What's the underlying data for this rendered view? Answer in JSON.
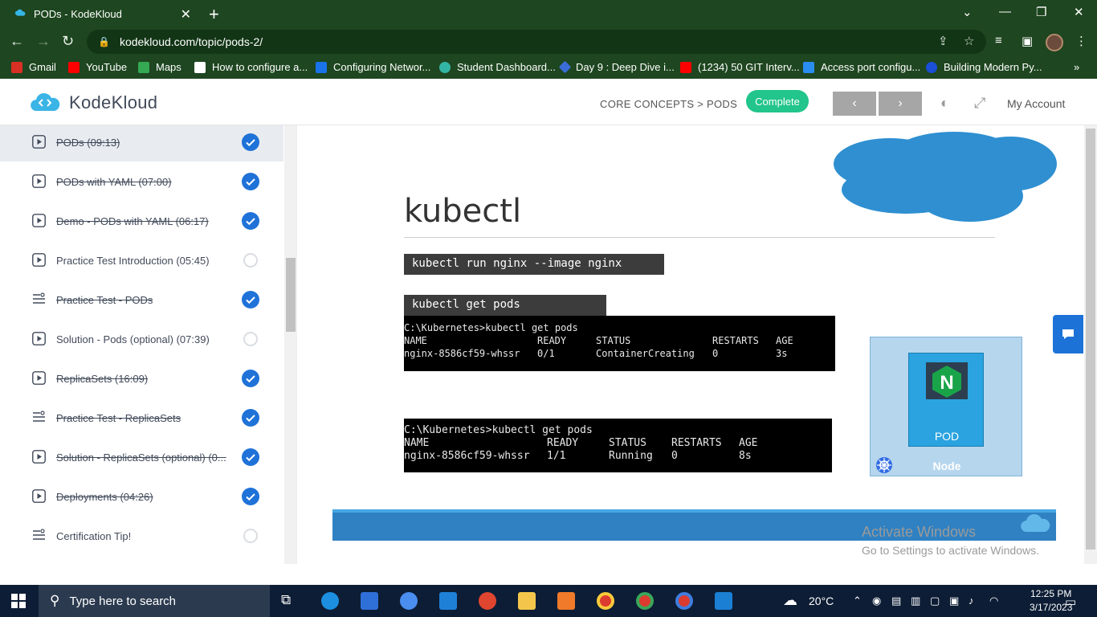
{
  "browser": {
    "tab_title": "PODs - KodeKloud",
    "url": "kodekloud.com/topic/pods-2/",
    "bookmarks": [
      {
        "label": "Gmail",
        "color": "#d93025"
      },
      {
        "label": "YouTube",
        "color": "#ff0000"
      },
      {
        "label": "Maps",
        "color": "#34a853"
      },
      {
        "label": "How to configure a...",
        "color": "#ffffff"
      },
      {
        "label": "Configuring Networ...",
        "color": "#1a73e8"
      },
      {
        "label": "Student Dashboard...",
        "color": "#33b5a5"
      },
      {
        "label": "Day 9 : Deep Dive i...",
        "color": "#3b6dd8"
      },
      {
        "label": "(1234) 50 GIT Interv...",
        "color": "#ff0000"
      },
      {
        "label": "Access port configu...",
        "color": "#2a8df0"
      },
      {
        "label": "Building Modern Py...",
        "color": "#1a4fd6"
      }
    ]
  },
  "header": {
    "logo": "KodeKloud",
    "breadcrumb": "CORE CONCEPTS > PODS",
    "complete_label": "Complete",
    "prev_label": "‹",
    "next_label": "›",
    "account_label": "My Account"
  },
  "sidebar": {
    "lessons": [
      {
        "title": "PODs (09:13)",
        "type": "video",
        "done": true,
        "active": true
      },
      {
        "title": "PODs with YAML (07:00)",
        "type": "video",
        "done": true,
        "active": false
      },
      {
        "title": "Demo - PODs with YAML (06:17)",
        "type": "video",
        "done": true,
        "active": false
      },
      {
        "title": "Practice Test Introduction (05:45)",
        "type": "video",
        "done": false,
        "active": false
      },
      {
        "title": "Practice Test - PODs",
        "type": "lab",
        "done": true,
        "active": false
      },
      {
        "title": "Solution - Pods (optional) (07:39)",
        "type": "video",
        "done": false,
        "active": false
      },
      {
        "title": "ReplicaSets (16:09)",
        "type": "video",
        "done": true,
        "active": false
      },
      {
        "title": "Practice Test - ReplicaSets",
        "type": "lab",
        "done": true,
        "active": false
      },
      {
        "title": "Solution - ReplicaSets (optional) (0...",
        "type": "video",
        "done": true,
        "active": false
      },
      {
        "title": "Deployments (04:26)",
        "type": "video",
        "done": true,
        "active": false
      },
      {
        "title": "Certification Tip!",
        "type": "lab",
        "done": false,
        "active": false
      }
    ]
  },
  "slide": {
    "title": "kubectl",
    "cmd1": "kubectl run nginx --image nginx",
    "cmd2": "kubectl get pods",
    "term1": {
      "prompt": "C:\\Kubernetes>kubectl get pods",
      "headers": [
        "NAME",
        "READY",
        "STATUS",
        "RESTARTS",
        "AGE"
      ],
      "row": [
        "nginx-8586cf59-whssr",
        "0/1",
        "ContainerCreating",
        "0",
        "3s"
      ]
    },
    "term2": {
      "prompt": "C:\\Kubernetes>kubectl get pods",
      "headers": [
        "NAME",
        "READY",
        "STATUS",
        "RESTARTS",
        "AGE"
      ],
      "row": [
        "nginx-8586cf59-whssr",
        "1/1",
        "Running",
        "0",
        "8s"
      ]
    },
    "pod_label": "POD",
    "node_label": "Node",
    "pod_logo_letter": "N"
  },
  "watermark": {
    "line1": "Activate Windows",
    "line2": "Go to Settings to activate Windows."
  },
  "taskbar": {
    "search_placeholder": "Type here to search",
    "weather": "20°C",
    "time": "12:25 PM",
    "date": "3/17/2023"
  }
}
